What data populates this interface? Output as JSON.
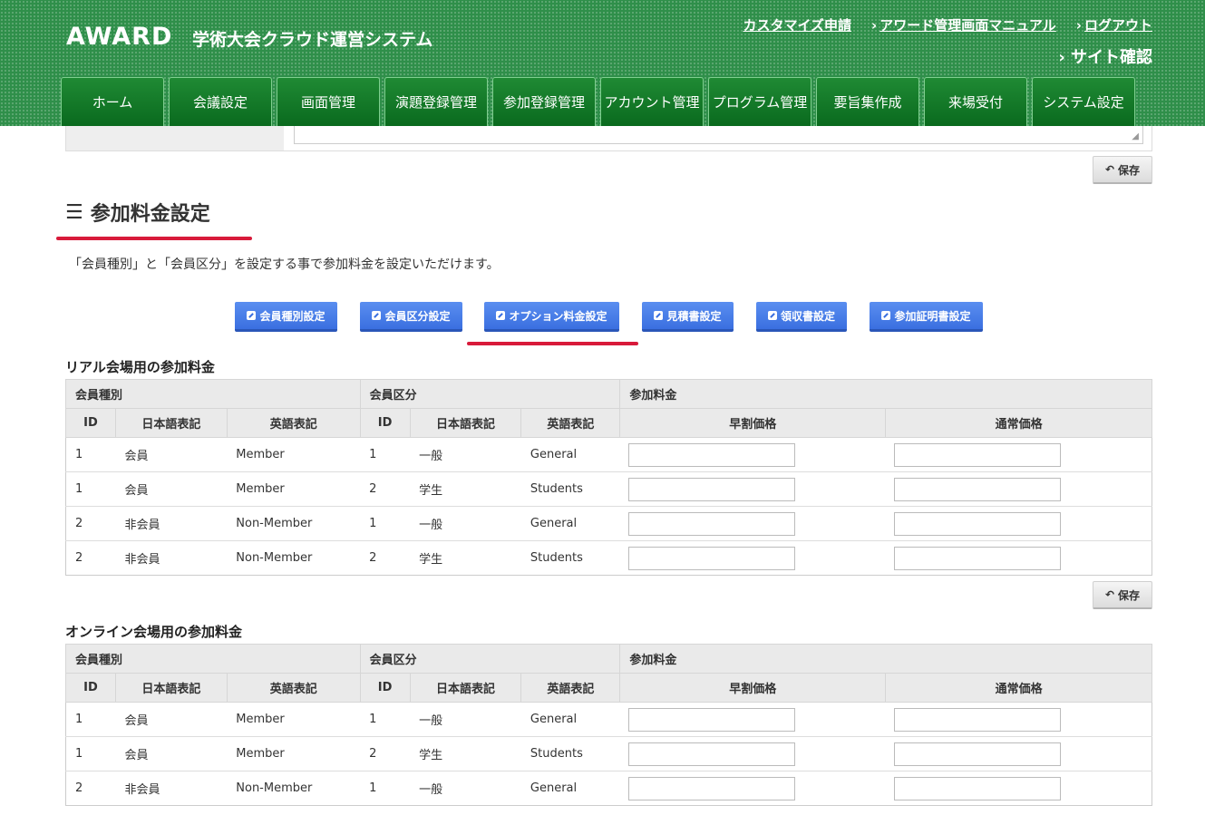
{
  "header": {
    "logo": "AWARD",
    "app_title": "学術大会クラウド運営システム",
    "links": [
      "カスタマイズ申請",
      "アワード管理画面マニュアル",
      "ログアウト"
    ],
    "site_check": "サイト確認",
    "nav_tabs": [
      "ホーム",
      "会議設定",
      "画面管理",
      "演題登録管理",
      "参加登録管理",
      "アカウント管理",
      "プログラム管理",
      "要旨集作成",
      "来場受付",
      "システム設定"
    ]
  },
  "save_label": "保存",
  "page": {
    "title": "参加料金設定",
    "description": "「会員種別」と「会員区分」を設定する事で参加料金を設定いただけます。"
  },
  "subnav": [
    "会員種別設定",
    "会員区分設定",
    "オプション料金設定",
    "見積書設定",
    "領収書設定",
    "参加証明書設定"
  ],
  "table_headers": {
    "groups": [
      "会員種別",
      "会員区分",
      "参加料金"
    ],
    "columns": [
      "ID",
      "日本語表記",
      "英語表記",
      "ID",
      "日本語表記",
      "英語表記",
      "早割価格",
      "通常価格"
    ]
  },
  "real_section": {
    "title": "リアル会場用の参加料金",
    "rows": [
      {
        "type_id": "1",
        "type_ja": "会員",
        "type_en": "Member",
        "cat_id": "1",
        "cat_ja": "一般",
        "cat_en": "General",
        "early": "",
        "regular": ""
      },
      {
        "type_id": "1",
        "type_ja": "会員",
        "type_en": "Member",
        "cat_id": "2",
        "cat_ja": "学生",
        "cat_en": "Students",
        "early": "",
        "regular": ""
      },
      {
        "type_id": "2",
        "type_ja": "非会員",
        "type_en": "Non-Member",
        "cat_id": "1",
        "cat_ja": "一般",
        "cat_en": "General",
        "early": "",
        "regular": ""
      },
      {
        "type_id": "2",
        "type_ja": "非会員",
        "type_en": "Non-Member",
        "cat_id": "2",
        "cat_ja": "学生",
        "cat_en": "Students",
        "early": "",
        "regular": ""
      }
    ]
  },
  "online_section": {
    "title": "オンライン会場用の参加料金",
    "rows": [
      {
        "type_id": "1",
        "type_ja": "会員",
        "type_en": "Member",
        "cat_id": "1",
        "cat_ja": "一般",
        "cat_en": "General",
        "early": "",
        "regular": ""
      },
      {
        "type_id": "1",
        "type_ja": "会員",
        "type_en": "Member",
        "cat_id": "2",
        "cat_ja": "学生",
        "cat_en": "Students",
        "early": "",
        "regular": ""
      },
      {
        "type_id": "2",
        "type_ja": "非会員",
        "type_en": "Non-Member",
        "cat_id": "1",
        "cat_ja": "一般",
        "cat_en": "General",
        "early": "",
        "regular": ""
      }
    ]
  },
  "colors": {
    "header_green": "#2f8f4a",
    "tab_green": "#0a6a1e",
    "button_blue": "#3a6fe0",
    "accent_red": "#d81a3a"
  }
}
